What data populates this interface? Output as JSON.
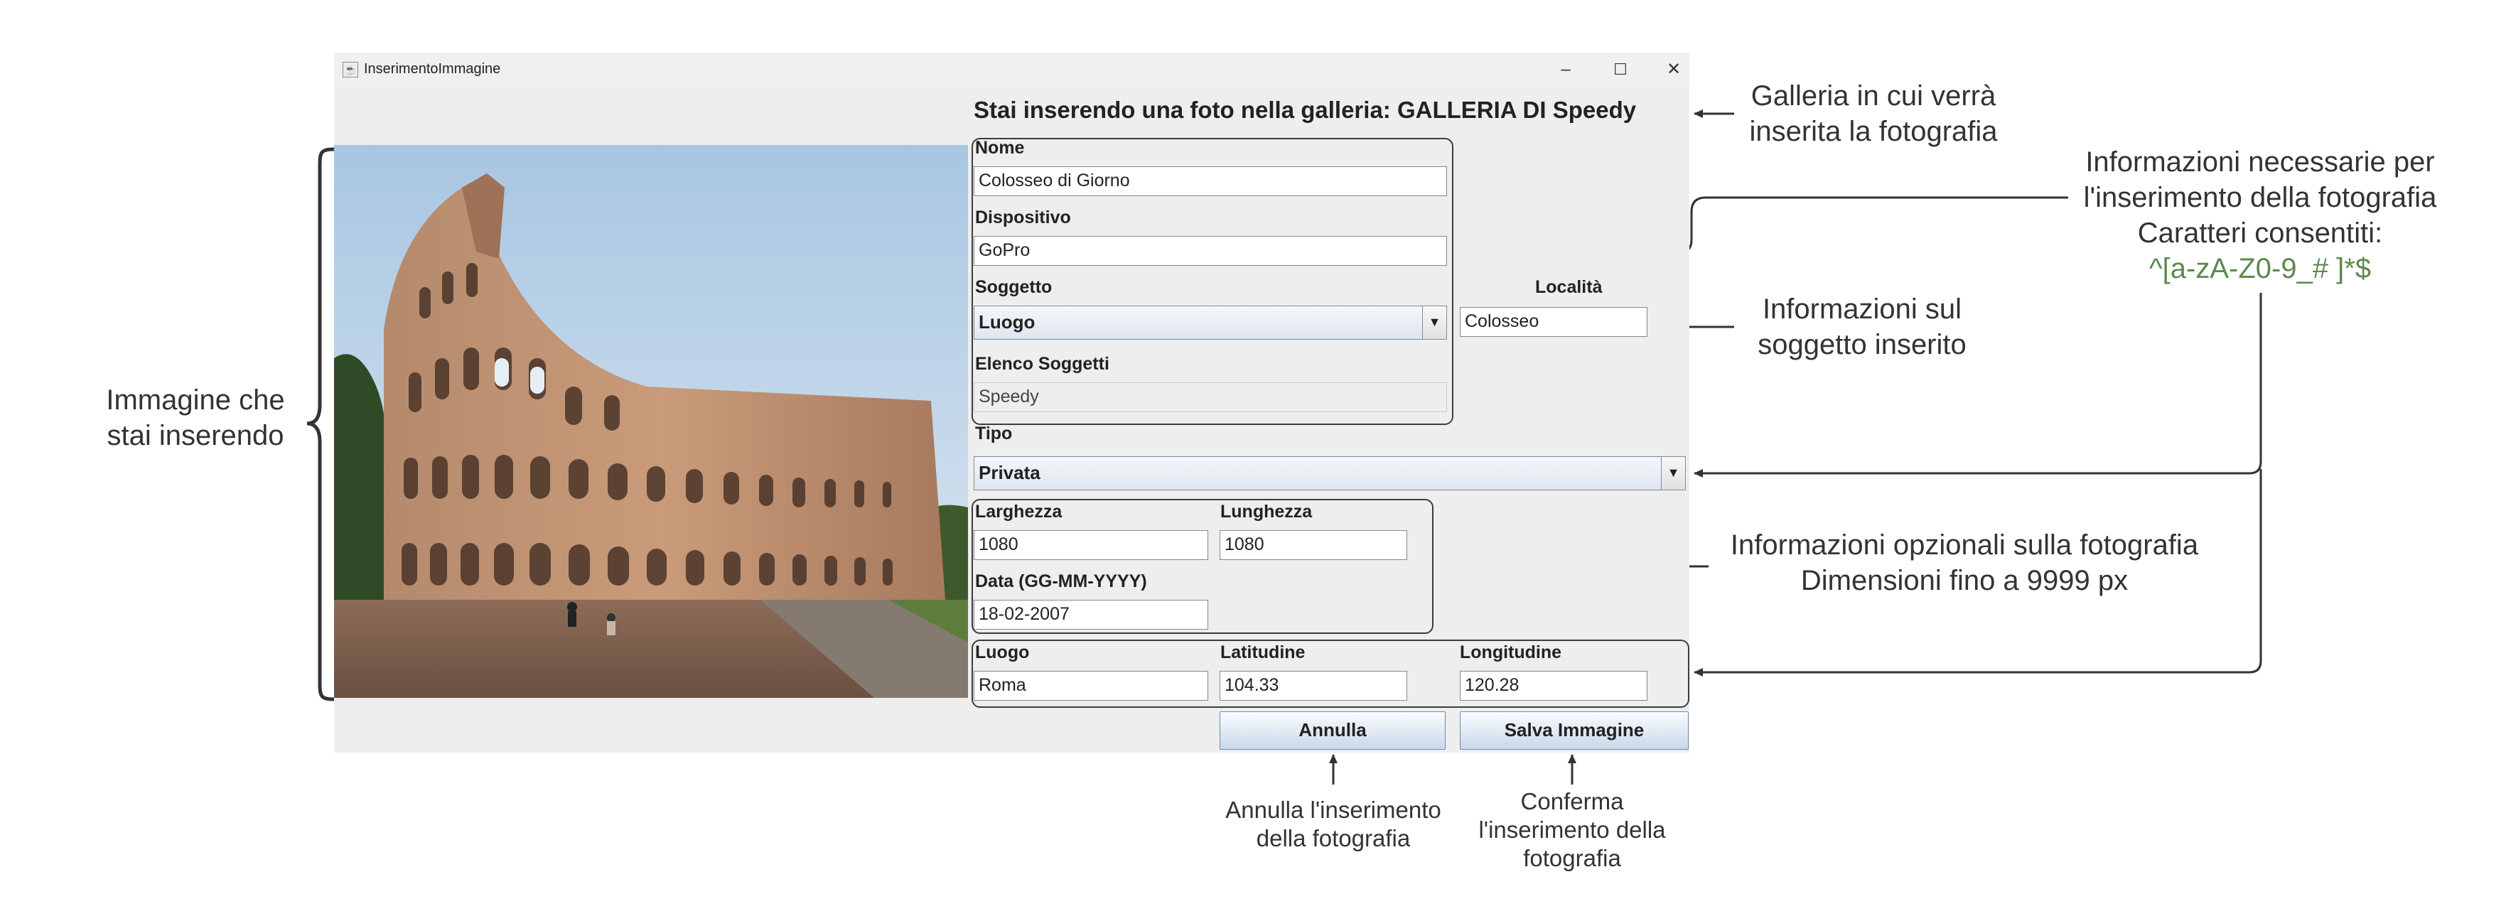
{
  "window": {
    "title": "InserimentoImmagine",
    "controls": {
      "minimize": "–",
      "maximize": "☐",
      "close": "✕"
    }
  },
  "header": {
    "text": "Stai inserendo una foto nella galleria:  GALLERIA DI Speedy"
  },
  "form": {
    "nome": {
      "label": "Nome",
      "value": "Colosseo di Giorno"
    },
    "dispositivo": {
      "label": "Dispositivo",
      "value": "GoPro"
    },
    "soggetto": {
      "label": "Soggetto",
      "value": "Luogo"
    },
    "localita": {
      "label": "Località",
      "value": "Colosseo"
    },
    "elenco_soggetti": {
      "label": "Elenco Soggetti",
      "value": "Speedy"
    },
    "tipo": {
      "label": "Tipo",
      "value": "Privata"
    },
    "larghezza": {
      "label": "Larghezza",
      "value": "1080"
    },
    "lunghezza": {
      "label": "Lunghezza",
      "value": "1080"
    },
    "data": {
      "label": "Data (GG-MM-YYYY)",
      "value": "18-02-2007"
    },
    "luogo": {
      "label": "Luogo",
      "value": "Roma"
    },
    "latitudine": {
      "label": "Latitudine",
      "value": "104.33"
    },
    "longitudine": {
      "label": "Longitudine",
      "value": "120.28"
    }
  },
  "buttons": {
    "annulla": "Annulla",
    "salva": "Salva Immagine"
  },
  "annotations": {
    "image_line1": "Immagine che",
    "image_line2": "stai inserendo",
    "gallery_line1": "Galleria in cui verrà",
    "gallery_line2": "inserita la fotografia",
    "required_line1": "Informazioni necessarie per",
    "required_line2": "l'inserimento della fotografia",
    "required_line3": "Caratteri consentiti:",
    "regex": "^[a-zA-Z0-9_# ]*$",
    "subject_line1": "Informazioni sul",
    "subject_line2": "soggetto inserito",
    "optional_line1": "Informazioni opzionali sulla fotografia",
    "optional_line2": "Dimensioni fino a 9999 px",
    "annulla_line1": "Annulla l'inserimento",
    "annulla_line2": "della fotografia",
    "conferma_line1": "Conferma",
    "conferma_line2": "l'inserimento della",
    "conferma_line3": "fotografia"
  },
  "colors": {
    "regex": "#5d8a4e",
    "button_gradient": "#c9d8e9",
    "window_bg": "#eeeeee"
  }
}
